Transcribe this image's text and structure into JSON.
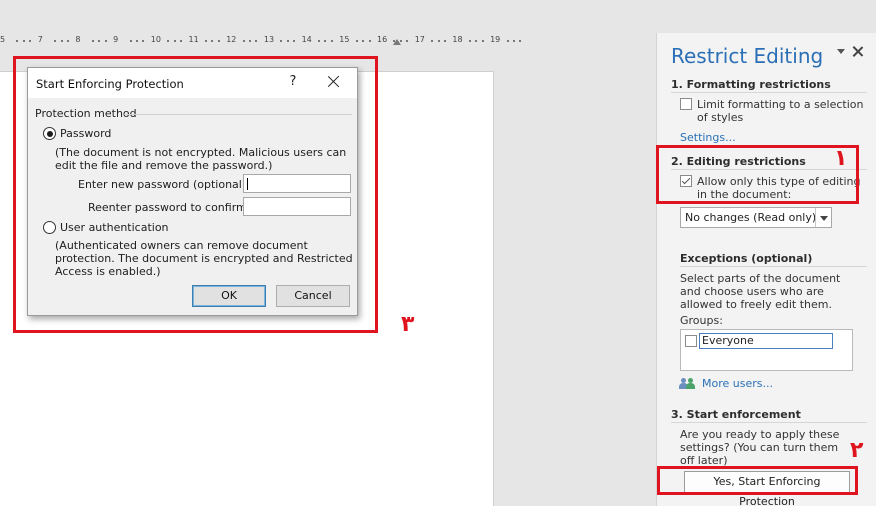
{
  "ruler": {
    "labels": [
      "5",
      "7",
      "8",
      "9",
      "10",
      "11",
      "12",
      "13",
      "14",
      "15",
      "16",
      "17",
      "18",
      "19"
    ]
  },
  "dialog": {
    "title": "Start Enforcing Protection",
    "help_label": "?",
    "group_label": "Protection method",
    "password_option": "Password",
    "password_desc": "(The document is not encrypted. Malicious users can edit the file and remove the password.)",
    "new_password_label": "Enter new password (optional):",
    "new_password_value": "",
    "confirm_password_label": "Reenter password to confirm:",
    "confirm_password_value": "",
    "user_auth_option": "User authentication",
    "user_auth_desc": "(Authenticated owners can remove document protection. The document is encrypted and Restricted Access is enabled.)",
    "ok_label": "OK",
    "cancel_label": "Cancel",
    "selected_method": "Password"
  },
  "pane": {
    "title": "Restrict Editing",
    "formatting": {
      "heading": "1. Formatting restrictions",
      "checkbox_label": "Limit formatting to a selection of styles",
      "checked": false,
      "settings_link": "Settings..."
    },
    "editing": {
      "heading": "2. Editing restrictions",
      "checkbox_label": "Allow only this type of editing in the document:",
      "checked": true,
      "dropdown_value": "No changes (Read only)"
    },
    "exceptions": {
      "heading": "Exceptions (optional)",
      "description": "Select parts of the document and choose users who are allowed to freely edit them.",
      "groups_label": "Groups:",
      "group_item": "Everyone",
      "group_checked": false,
      "more_users_link": "More users..."
    },
    "enforcement": {
      "heading": "3. Start enforcement",
      "description": "Are you ready to apply these settings? (You can turn them off later)",
      "button_label": "Yes, Start Enforcing Protection"
    }
  },
  "annotations": {
    "marker_1": "١",
    "marker_2": "٢",
    "marker_3": "٣",
    "color": "#e0141e"
  },
  "colors": {
    "accent": "#2b6fb6",
    "pane_bg": "#f3f3f3",
    "dialog_bg": "#f0f0f0"
  }
}
